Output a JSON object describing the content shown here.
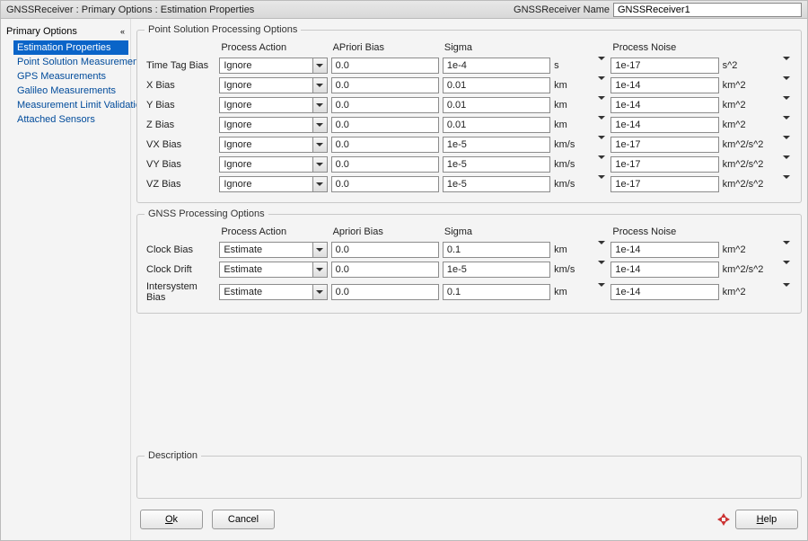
{
  "title": {
    "crumbs": "GNSSReceiver : Primary Options : Estimation Properties",
    "name_label": "GNSSReceiver Name",
    "name_value": "GNSSReceiver1"
  },
  "sidebar": {
    "group": "Primary Options",
    "items": [
      "Estimation Properties",
      "Point Solution Measurements",
      "GPS Measurements",
      "Galileo Measurements",
      "Measurement Limit Validation",
      "Attached Sensors"
    ],
    "selected_index": 0
  },
  "groups": {
    "point": {
      "legend": "Point Solution Processing Options",
      "headers": [
        "Process Action",
        "APriori Bias",
        "Sigma",
        "Process Noise"
      ],
      "rows": [
        {
          "label": "Time Tag Bias",
          "action": "Ignore",
          "apriori": "0.0",
          "sigma": "1e-4",
          "unit": "s",
          "noise": "1e-17",
          "unit2": "s^2"
        },
        {
          "label": "X Bias",
          "action": "Ignore",
          "apriori": "0.0",
          "sigma": "0.01",
          "unit": "km",
          "noise": "1e-14",
          "unit2": "km^2"
        },
        {
          "label": "Y Bias",
          "action": "Ignore",
          "apriori": "0.0",
          "sigma": "0.01",
          "unit": "km",
          "noise": "1e-14",
          "unit2": "km^2"
        },
        {
          "label": "Z Bias",
          "action": "Ignore",
          "apriori": "0.0",
          "sigma": "0.01",
          "unit": "km",
          "noise": "1e-14",
          "unit2": "km^2"
        },
        {
          "label": "VX Bias",
          "action": "Ignore",
          "apriori": "0.0",
          "sigma": "1e-5",
          "unit": "km/s",
          "noise": "1e-17",
          "unit2": "km^2/s^2"
        },
        {
          "label": "VY Bias",
          "action": "Ignore",
          "apriori": "0.0",
          "sigma": "1e-5",
          "unit": "km/s",
          "noise": "1e-17",
          "unit2": "km^2/s^2"
        },
        {
          "label": "VZ Bias",
          "action": "Ignore",
          "apriori": "0.0",
          "sigma": "1e-5",
          "unit": "km/s",
          "noise": "1e-17",
          "unit2": "km^2/s^2"
        }
      ]
    },
    "gnss": {
      "legend": "GNSS Processing Options",
      "headers": [
        "Process Action",
        "Apriori Bias",
        "Sigma",
        "Process Noise"
      ],
      "rows": [
        {
          "label": "Clock Bias",
          "action": "Estimate",
          "apriori": "0.0",
          "sigma": "0.1",
          "unit": "km",
          "noise": "1e-14",
          "unit2": "km^2"
        },
        {
          "label": "Clock Drift",
          "action": "Estimate",
          "apriori": "0.0",
          "sigma": "1e-5",
          "unit": "km/s",
          "noise": "1e-14",
          "unit2": "km^2/s^2"
        },
        {
          "label": "Intersystem Bias",
          "action": "Estimate",
          "apriori": "0.0",
          "sigma": "0.1",
          "unit": "km",
          "noise": "1e-14",
          "unit2": "km^2"
        }
      ]
    },
    "description": {
      "legend": "Description"
    }
  },
  "footer": {
    "ok": "Ok",
    "cancel": "Cancel",
    "help": "Help"
  }
}
